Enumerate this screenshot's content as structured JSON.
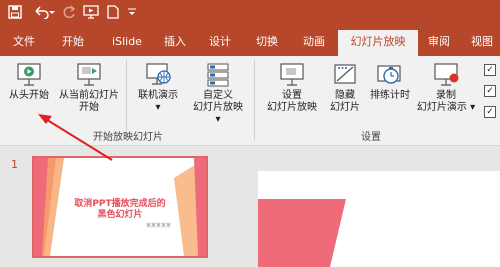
{
  "quick_access": {
    "save_icon": "save-icon",
    "undo_icon": "undo-icon",
    "redo_icon": "redo-icon",
    "present_icon": "present-from-start-icon",
    "new_icon": "new-file-icon",
    "customize_icon": "chevron-down-icon"
  },
  "tabs": [
    "文件",
    "开始",
    "iSlide",
    "插入",
    "设计",
    "切换",
    "动画",
    "幻灯片放映",
    "审阅",
    "视图"
  ],
  "active_tab": "幻灯片放映",
  "ribbon": {
    "start_group": {
      "from_beginning": "从头开始",
      "from_current_line1": "从当前幻灯片",
      "from_current_line2": "开始",
      "online_present": "联机演示",
      "online_present_arrow": "▾",
      "custom_line1": "自定义",
      "custom_line2": "幻灯片放映",
      "custom_arrow": "▾",
      "label": "开始放映幻灯片"
    },
    "setup_group": {
      "setup_show_line1": "设置",
      "setup_show_line2": "幻灯片放映",
      "hide_slide_line1": "隐藏",
      "hide_slide_line2": "幻灯片",
      "rehearse": "排练计时",
      "record_line1": "录制",
      "record_line2": "幻灯片演示",
      "record_arrow": "▾",
      "label": "设置"
    },
    "checkboxes": [
      "✓",
      "✓",
      "✓"
    ]
  },
  "slides": {
    "number": "1",
    "thumb_title_line1": "取消PPT播放完成后的",
    "thumb_title_line2": "黑色幻灯片",
    "thumb_subtitle": "某某某某某"
  },
  "colors": {
    "accent": "#b7472a",
    "slide_pink": "#f06b7a",
    "slide_orange": "#f7a56a"
  }
}
